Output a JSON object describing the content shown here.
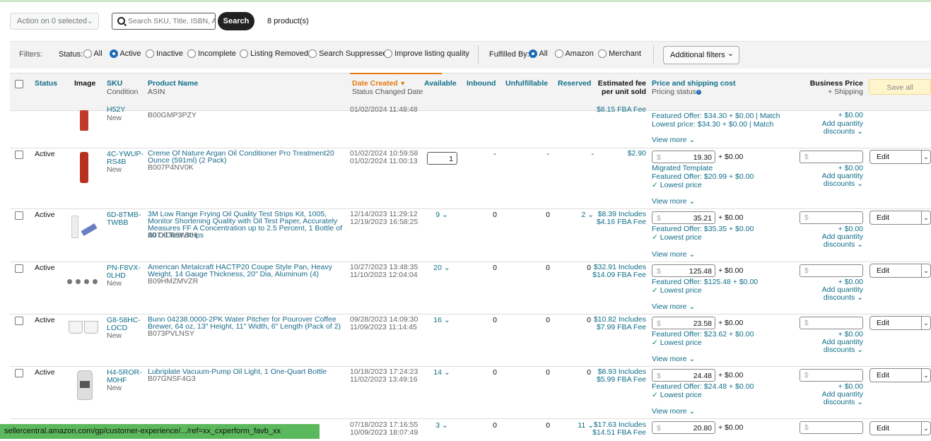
{
  "toolbar": {
    "action_label": "Action on 0 selected",
    "search_placeholder": "Search SKU, Title, ISBN, ASIN",
    "search_button": "Search",
    "product_count": "8 product(s)"
  },
  "filters": {
    "label": "Filters:",
    "status_label": "Status:",
    "status_options": [
      "All",
      "Active",
      "Inactive",
      "Incomplete",
      "Listing Removed",
      "Search Suppressed",
      "Improve listing quality"
    ],
    "status_selected": "Active",
    "fulfilled_label": "Fulfilled By:",
    "fulfilled_options": [
      "All",
      "Amazon",
      "Merchant"
    ],
    "fulfilled_selected": "All",
    "additional_filters": "Additional filters"
  },
  "columns": {
    "status": "Status",
    "image": "Image",
    "sku": "SKU",
    "condition": "Condition",
    "product_name": "Product Name",
    "asin": "ASIN",
    "date_created": "Date Created",
    "status_changed": "Status Changed Date",
    "available": "Available",
    "inbound": "Inbound",
    "unfulfillable": "Unfulfillable",
    "reserved": "Reserved",
    "est_fee_1": "Estimated fee",
    "est_fee_2": "per unit sold",
    "price_shipping": "Price and shipping cost",
    "pricing_status": "Pricing status",
    "business_price": "Business Price",
    "plus_shipping": "+ Shipping",
    "save_all": "Save all"
  },
  "partial_row": {
    "sku": "H52Y",
    "condition": "New",
    "asin": "B00GMP3PZY",
    "date1": "01/02/2024 11:48:48",
    "fee": "$8.15 FBA Fee",
    "featured": "Featured Offer: $34.30 + $0.00",
    "match1": "Match",
    "lowest": "Lowest price: $34.30 + $0.00",
    "match2": "Match",
    "view_more": "View more",
    "biz_ship": "+ $0.00",
    "add_qty": "Add quantity",
    "discounts": "discounts"
  },
  "rows": [
    {
      "status": "Active",
      "sku1": "4C-YWUP-",
      "sku2": "RS4B",
      "condition": "New",
      "name": "Creme Of Nature Argan Oil Conditioner Pro Treatment20 Ounce (591ml) (2 Pack)",
      "asin": "B007P4NV0K",
      "date1": "01/02/2024 10:59:58",
      "date2": "01/02/2024 11:00:13",
      "available": "1",
      "inbound": "-",
      "unfulfillable": "-",
      "reserved": "",
      "fee1": "$2.90",
      "fee2": "",
      "price_dollar": "$",
      "price": "19.30",
      "ship": "+ $0.00",
      "template": "Migrated Template",
      "featured": "Featured Offer: $20.99 + $0.00",
      "lowest": "Lowest price",
      "view_more": "View more",
      "biz_placeholder": "$",
      "biz_ship": "+ $0.00",
      "add_qty": "Add quantity",
      "discounts": "discounts",
      "edit": "Edit"
    },
    {
      "status": "Active",
      "sku1": "6D-8TMB-",
      "sku2": "TWBB",
      "condition": "",
      "name": "3M Low Range Frying Oil Quality Test Strips Kit, 1005, Monitor Shortening Quality with Oil Test Paper, Accurately Measures FF A Concentration up to 2.5 Percent, 1 Bottle of 40 Oil Test Strips",
      "asin": "B07XD68WKH",
      "date1": "12/14/2023 11:29:12",
      "date2": "12/19/2023 16:58:25",
      "available": "9",
      "inbound": "0",
      "unfulfillable": "0",
      "reserved": "2",
      "fee1": "$8.39 Includes",
      "fee2": "$4.16 FBA Fee",
      "price_dollar": "$",
      "price": "35.21",
      "ship": "+ $0.00",
      "template": "",
      "featured": "Featured Offer: $35.35 + $0.00",
      "lowest": "Lowest price",
      "view_more": "View more",
      "biz_placeholder": "$",
      "biz_ship": "+ $0.00",
      "add_qty": "Add quantity",
      "discounts": "discounts",
      "edit": "Edit"
    },
    {
      "status": "Active",
      "sku1": "PN-F8VX-",
      "sku2": "0LHD",
      "condition": "New",
      "name": "American Metalcraft HACTP20 Coupe Style Pan, Heavy Weight, 14 Gauge Thickness, 20\" Dia, Aluminum (4)",
      "asin": "B09HMZMVZR",
      "date1": "10/27/2023 13:48:35",
      "date2": "11/10/2023 12:04:04",
      "available": "20",
      "inbound": "0",
      "unfulfillable": "0",
      "reserved": "0",
      "fee1": "$32.91 Includes",
      "fee2": "$14.09 FBA Fee",
      "price_dollar": "$",
      "price": "125.48",
      "ship": "+ $0.00",
      "template": "",
      "featured": "Featured Offer: $125.48 + $0.00",
      "lowest": "Lowest price",
      "view_more": "View more",
      "biz_placeholder": "$",
      "biz_ship": "+ $0.00",
      "add_qty": "Add quantity",
      "discounts": "discounts",
      "edit": "Edit"
    },
    {
      "status": "Active",
      "sku1": "G8-58HC-",
      "sku2": "LOCD",
      "condition": "New",
      "name": "Bunn 04238.0000-2PK Water Pitcher for Pourover Coffee Brewer, 64 oz, 13\" Height, 11\" Width, 6\" Length (Pack of 2)",
      "asin": "B073PVLNSY",
      "date1": "09/28/2023 14:09:30",
      "date2": "11/09/2023 11:14:45",
      "available": "16",
      "inbound": "0",
      "unfulfillable": "0",
      "reserved": "0",
      "fee1": "$10.82 Includes",
      "fee2": "$7.99 FBA Fee",
      "price_dollar": "$",
      "price": "23.58",
      "ship": "+ $0.00",
      "template": "",
      "featured": "Featured Offer: $23.62 + $0.00",
      "lowest": "Lowest price",
      "view_more": "View more",
      "biz_placeholder": "$",
      "biz_ship": "+ $0.00",
      "add_qty": "Add quantity",
      "discounts": "discounts",
      "edit": "Edit"
    },
    {
      "status": "Active",
      "sku1": "H4-5ROR-",
      "sku2": "M0HF",
      "condition": "New",
      "name": "Lubriplate Vacuum-Pump Oil Light, 1 One-Quart Bottle",
      "asin": "B07GNSF4G3",
      "date1": "10/18/2023 17:24:23",
      "date2": "11/02/2023 13:49:16",
      "available": "14",
      "inbound": "0",
      "unfulfillable": "0",
      "reserved": "0",
      "fee1": "$8.93 Includes",
      "fee2": "$5.99 FBA Fee",
      "price_dollar": "$",
      "price": "24.48",
      "ship": "+ $0.00",
      "template": "",
      "featured": "Featured Offer: $24.48 + $0.00",
      "lowest": "Lowest price",
      "view_more": "View more",
      "biz_placeholder": "$",
      "biz_ship": "+ $0.00",
      "add_qty": "Add quantity",
      "discounts": "discounts",
      "edit": "Edit"
    }
  ],
  "last_row": {
    "date1": "07/18/2023 17:16:55",
    "date2": "10/09/2023 18:07:49",
    "available": "3",
    "inbound": "0",
    "unfulfillable": "0",
    "reserved": "11",
    "fee1": "$17.63 Includes",
    "fee2": "$14.51 FBA Fee",
    "price_dollar": "$",
    "price": "20.80",
    "ship": "+ $0.00",
    "biz_placeholder": "$",
    "edit": "Edit"
  },
  "status_url": "sellercentral.amazon.com/gp/customer-experience/.../ref=xx_cxperform_favb_xx",
  "colors": {
    "link": "#0f6e8a",
    "accent_orange": "#e47911",
    "radio_on": "#1a6bb5",
    "save_all_bg": "#fff5cc",
    "status_bar": "#5cb85c"
  }
}
